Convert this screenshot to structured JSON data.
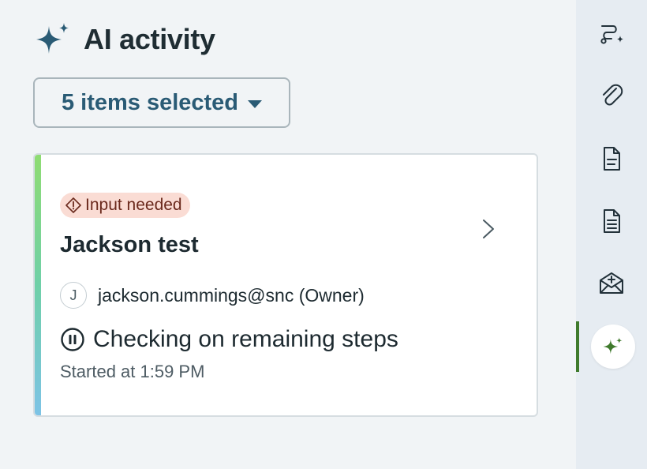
{
  "panel": {
    "title": "AI activity",
    "title_icon": "sparkle-icon"
  },
  "filter": {
    "label": "5 items selected",
    "icon": "caret-down-icon"
  },
  "activity_card": {
    "badge": "Input needed",
    "badge_icon": "warning-diamond-icon",
    "title": "Jackson test",
    "owner_initial": "J",
    "owner": "jackson.cummings@snc (Owner)",
    "status_icon": "pause-circle-icon",
    "status": "Checking on remaining steps",
    "started": "Started at 1:59 PM",
    "colors": {
      "accent_top": "#8fdc72",
      "accent_bottom": "#7dc3e6",
      "badge_bg": "#fadcd4"
    }
  },
  "sidebar": {
    "items": [
      {
        "icon": "flow-sparkle-icon",
        "active": false
      },
      {
        "icon": "paperclip-icon",
        "active": false
      },
      {
        "icon": "document-icon",
        "active": false
      },
      {
        "icon": "document-lines-icon",
        "active": false
      },
      {
        "icon": "mail-plus-icon",
        "active": false
      },
      {
        "icon": "sparkle-icon",
        "active": true
      }
    ],
    "active_color": "#3f7a2c"
  }
}
